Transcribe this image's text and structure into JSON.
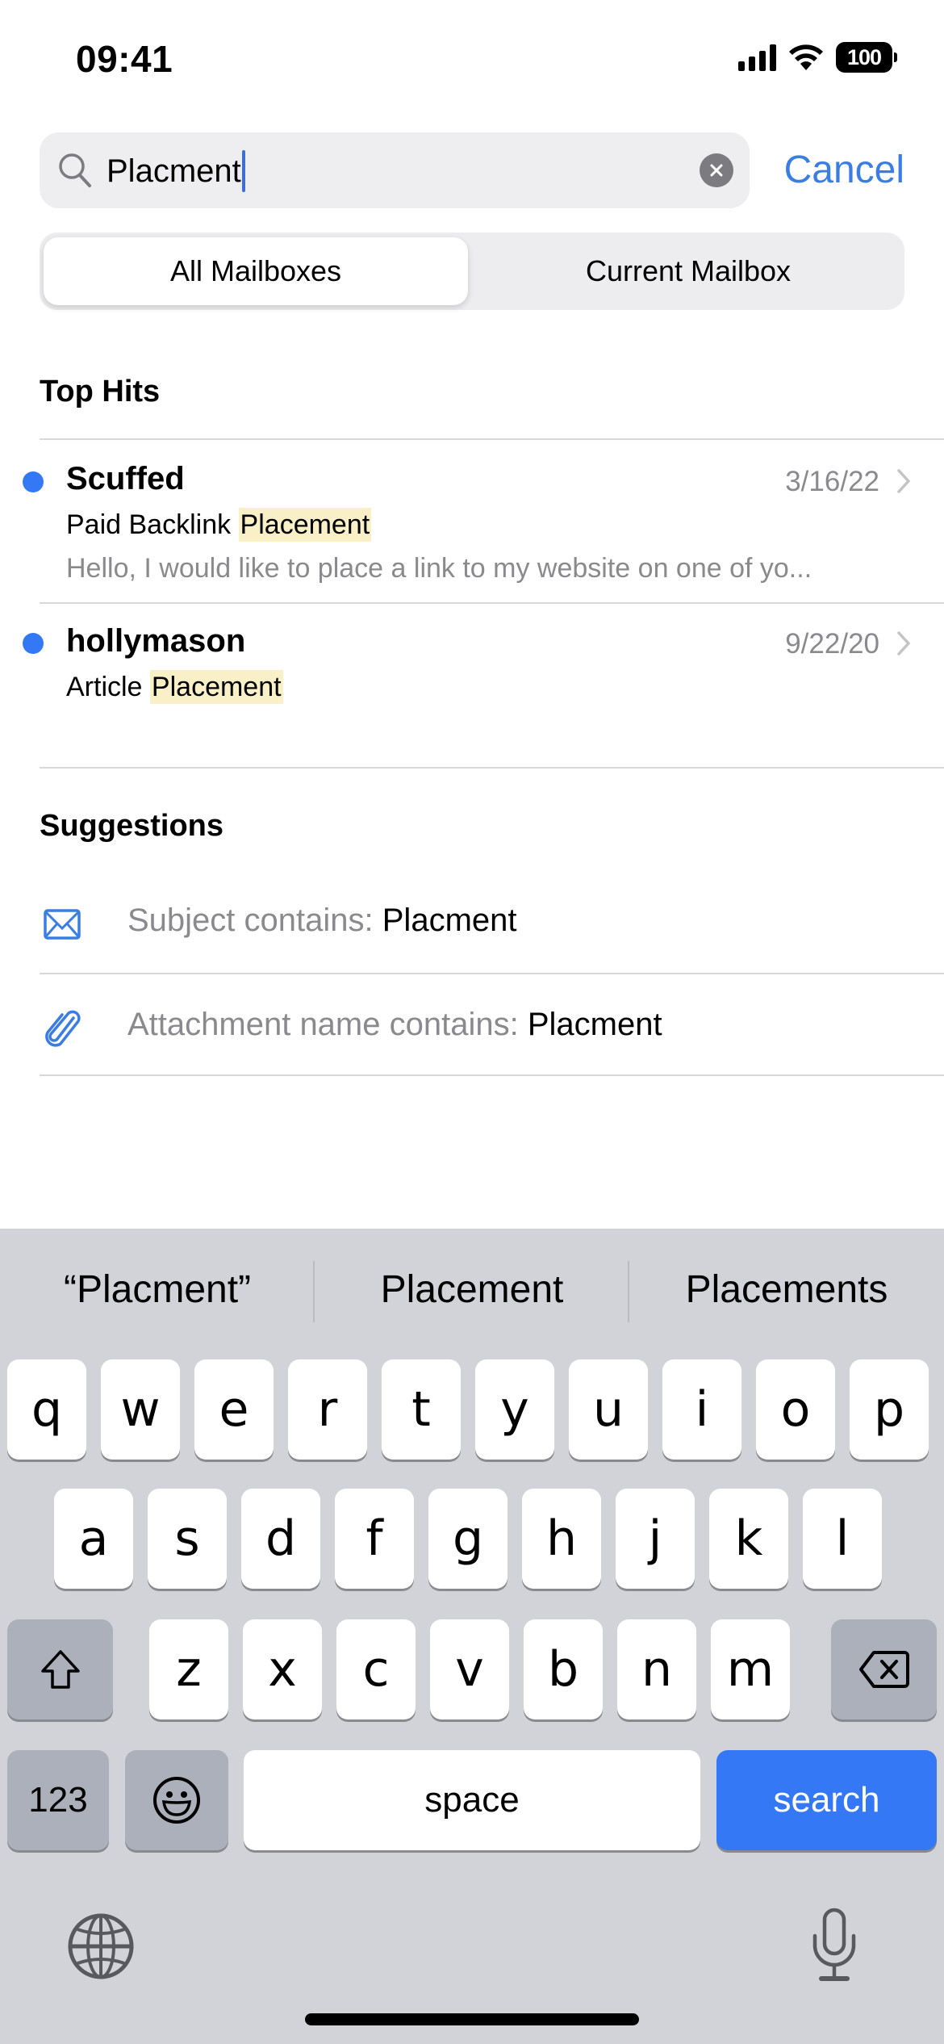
{
  "status_bar": {
    "time": "09:41",
    "battery": "100",
    "icons": [
      "cellular-signal-icon",
      "wifi-icon",
      "battery-icon"
    ]
  },
  "search": {
    "query": "Placment",
    "cancel_label": "Cancel",
    "icons": {
      "search": "search-icon",
      "clear": "clear-icon"
    }
  },
  "scope": {
    "options": [
      "All Mailboxes",
      "Current Mailbox"
    ],
    "selected": "All Mailboxes"
  },
  "top_hits": {
    "title": "Top Hits",
    "items": [
      {
        "sender": "Scuffed",
        "date": "3/16/22",
        "subject_prefix": "Paid Backlink ",
        "subject_highlight": "Placement",
        "preview": "Hello, I would like to place a link to my website on one of yo...",
        "unread": true
      },
      {
        "sender": "hollymason",
        "date": "9/22/20",
        "subject_prefix": "Article ",
        "subject_highlight": "Placement",
        "preview": "",
        "unread": true
      }
    ]
  },
  "suggestions": {
    "title": "Suggestions",
    "items": [
      {
        "icon": "envelope-icon",
        "label": "Subject contains: ",
        "value": "Placment"
      },
      {
        "icon": "paperclip-icon",
        "label": "Attachment name contains: ",
        "value": "Placment"
      }
    ]
  },
  "keyboard": {
    "predictions": [
      "“Placment”",
      "Placement",
      "Placements"
    ],
    "row1": [
      "q",
      "w",
      "e",
      "r",
      "t",
      "y",
      "u",
      "i",
      "o",
      "p"
    ],
    "row2": [
      "a",
      "s",
      "d",
      "f",
      "g",
      "h",
      "j",
      "k",
      "l"
    ],
    "row3": [
      "z",
      "x",
      "c",
      "v",
      "b",
      "n",
      "m"
    ],
    "numbers_label": "123",
    "space_label": "space",
    "action_label": "search",
    "icons": [
      "shift-icon",
      "delete-icon",
      "emoji-icon",
      "globe-icon",
      "microphone-icon"
    ]
  },
  "colors": {
    "accent": "#3478f6",
    "link": "#3b7de0",
    "highlight": "#faf0c8",
    "keyboard_bg": "#d1d3d9",
    "secondary_text": "#8a8a8e"
  }
}
